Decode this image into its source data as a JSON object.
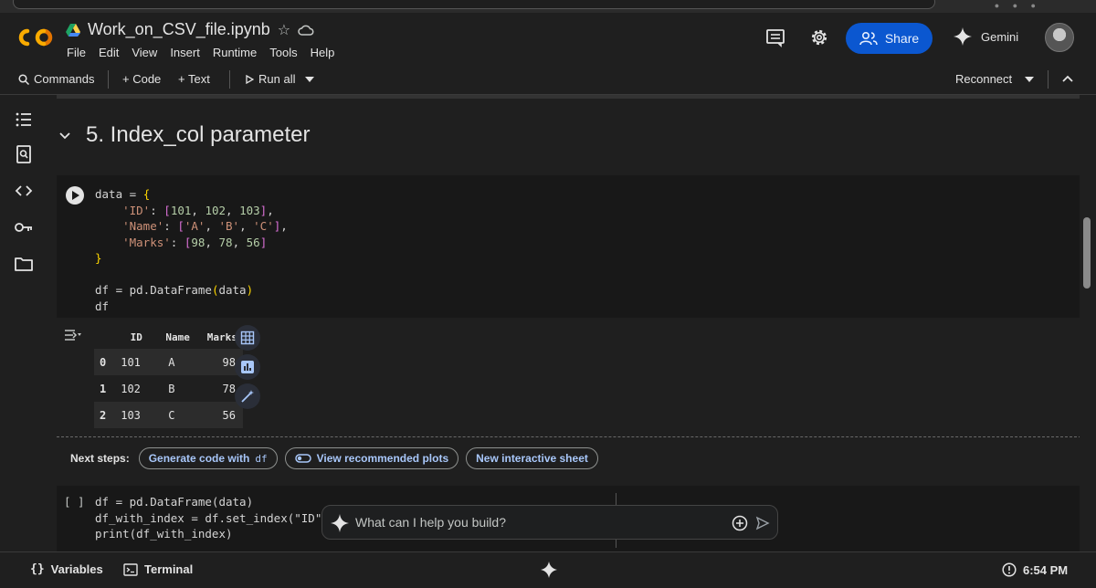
{
  "header": {
    "doc_title": "Work_on_CSV_file.ipynb",
    "menu": [
      "File",
      "Edit",
      "View",
      "Insert",
      "Runtime",
      "Tools",
      "Help"
    ],
    "share_label": "Share",
    "gemini_label": "Gemini"
  },
  "toolbar": {
    "commands": "Commands",
    "add_code": "+ Code",
    "add_text": "+ Text",
    "run_all": "Run all",
    "reconnect": "Reconnect"
  },
  "section": {
    "title": "5. Index_col parameter"
  },
  "cell1": {
    "code_lines": [
      "data = {",
      "    'ID': [101, 102, 103],",
      "    'Name': ['A', 'B', 'C'],",
      "    'Marks': [98, 78, 56]",
      "}",
      "",
      "df = pd.DataFrame(data)",
      "df"
    ]
  },
  "output": {
    "columns": [
      "",
      "ID",
      "Name",
      "Marks"
    ],
    "rows": [
      [
        "0",
        "101",
        "A",
        "98"
      ],
      [
        "1",
        "102",
        "B",
        "78"
      ],
      [
        "2",
        "103",
        "C",
        "56"
      ]
    ]
  },
  "next_steps": {
    "label": "Next steps:",
    "generate": "Generate code with",
    "generate_var": "df",
    "plots": "View recommended plots",
    "sheet": "New interactive sheet"
  },
  "cell2": {
    "brackets": "[ ]",
    "code_lines": [
      "df = pd.DataFrame(data)",
      "df_with_index = df.set_index(\"ID\")",
      "print(df_with_index)"
    ]
  },
  "ask": {
    "placeholder": "What can I help you build?"
  },
  "status": {
    "variables": "Variables",
    "terminal": "Terminal",
    "time": "6:54 PM"
  },
  "colors": {
    "accent": "#0b57d0",
    "chip_text": "#a8c7fa",
    "logo_orange": "#f9ab00",
    "logo_dark_orange": "#e37400"
  }
}
